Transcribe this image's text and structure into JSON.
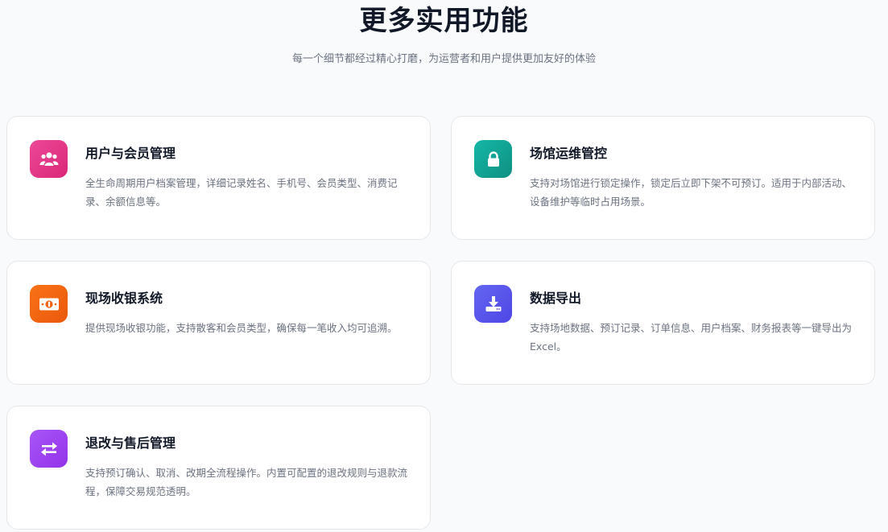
{
  "header": {
    "title": "更多实用功能",
    "subtitle": "每一个细节都经过精心打磨，为运营者和用户提供更加友好的体验"
  },
  "features": [
    {
      "title": "用户与会员管理",
      "description": "全生命周期用户档案管理，详细记录姓名、手机号、会员类型、消费记录、余额信息等。",
      "icon": "users-icon",
      "color": "#e93d8f"
    },
    {
      "title": "场馆运维管控",
      "description": "支持对场馆进行锁定操作，锁定后立即下架不可预订。适用于内部活动、设备维护等临时占用场景。",
      "icon": "lock-icon",
      "color": "#12a597"
    },
    {
      "title": "现场收银系统",
      "description": "提供现场收银功能，支持散客和会员类型，确保每一笔收入均可追溯。",
      "icon": "cash-icon",
      "color": "#f2620f"
    },
    {
      "title": "数据导出",
      "description": "支持场地数据、预订记录、订单信息、用户档案、财务报表等一键导出为 Excel。",
      "icon": "download-icon",
      "color": "#5b50e8"
    },
    {
      "title": "退改与售后管理",
      "description": "支持预订确认、取消、改期全流程操作。内置可配置的退改规则与退款流程，保障交易规范透明。",
      "icon": "exchange-icon",
      "color": "#9b46ee"
    }
  ]
}
